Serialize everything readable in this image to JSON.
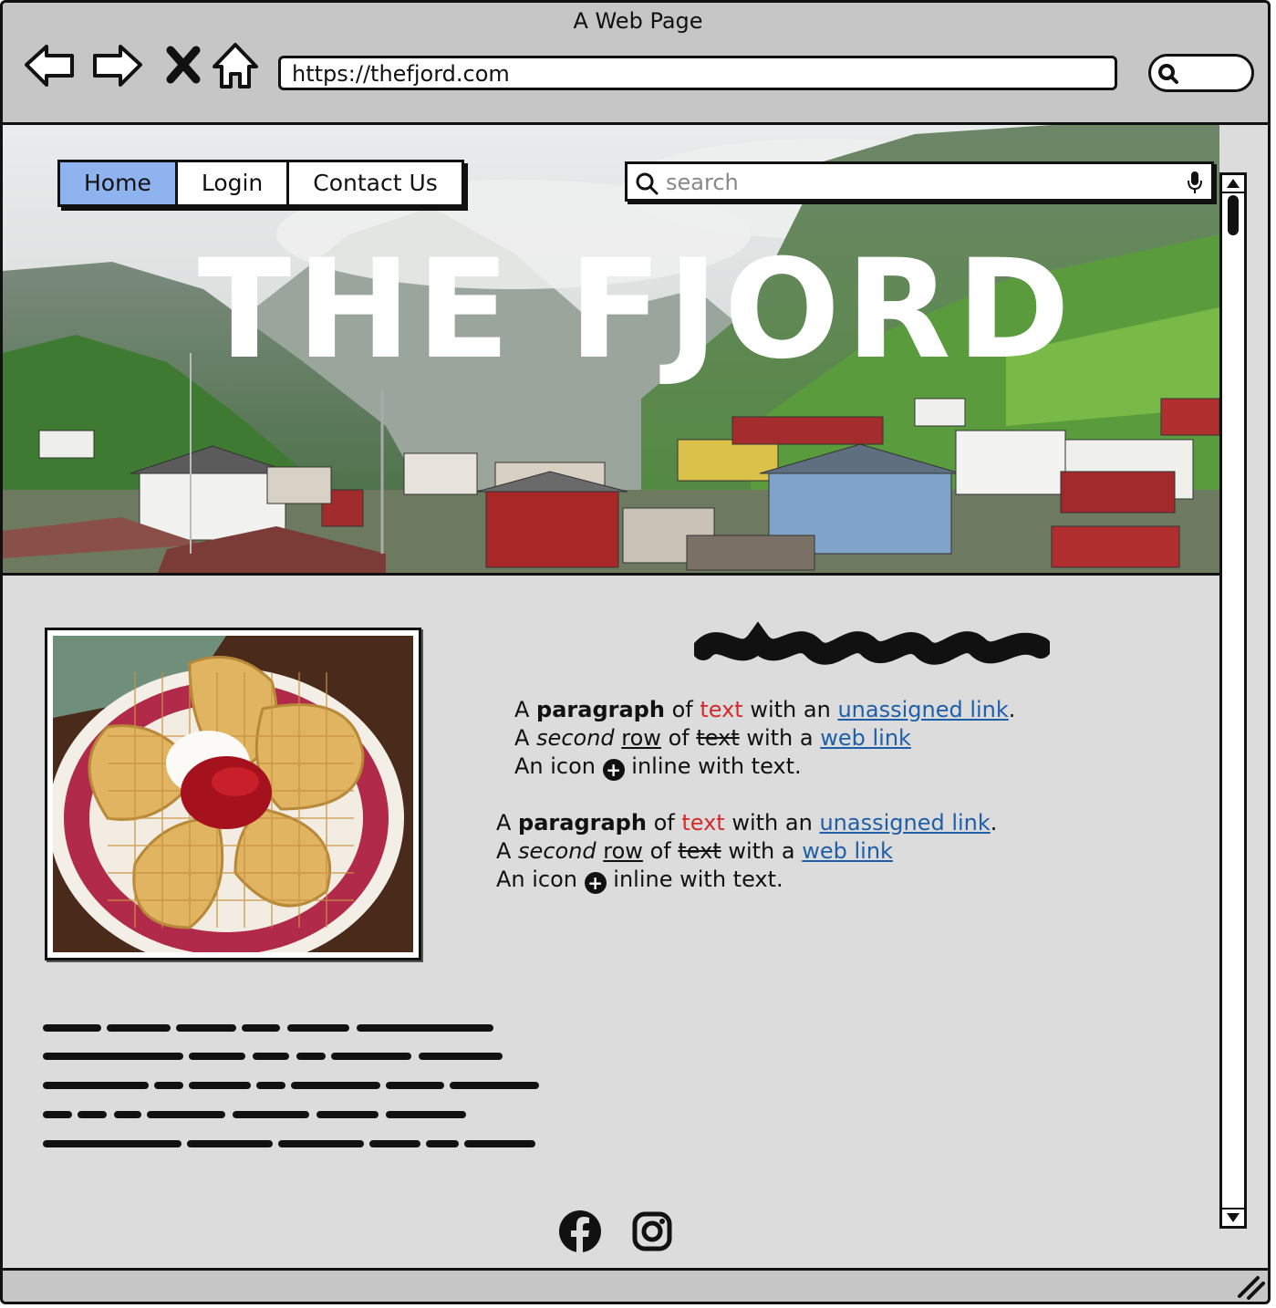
{
  "window": {
    "title": "A Web Page"
  },
  "browser": {
    "url": "https://thefjord.com",
    "buttons": [
      "back-icon",
      "forward-icon",
      "close-icon",
      "home-icon"
    ]
  },
  "nav": {
    "tabs": [
      {
        "label": "Home",
        "active": true
      },
      {
        "label": "Login",
        "active": false
      },
      {
        "label": "Contact Us",
        "active": false
      }
    ]
  },
  "search": {
    "placeholder": "search"
  },
  "hero": {
    "title": "THE FJORD"
  },
  "paragraph1": {
    "l1_a": "A ",
    "l1_bold": "paragraph",
    "l1_b": " of ",
    "l1_red": "text",
    "l1_c": " with an ",
    "l1_link": "unassigned link",
    "l1_d": ".",
    "l2_a": "A ",
    "l2_italic": "second",
    "l2_b": " ",
    "l2_underline": "row",
    "l2_c": " of ",
    "l2_strike": "text",
    "l2_d": " with a ",
    "l2_link": "web link",
    "l3_a": "An icon ",
    "l3_b": " inline with text."
  },
  "paragraph2": {
    "l1_a": "A ",
    "l1_bold": "paragraph",
    "l1_b": " of ",
    "l1_red": "text",
    "l1_c": " with an ",
    "l1_link": "unassigned link",
    "l1_d": ".",
    "l2_a": "A ",
    "l2_italic": "second",
    "l2_b": " ",
    "l2_underline": "row",
    "l2_c": " of ",
    "l2_strike": "text",
    "l2_d": " with a ",
    "l2_link": "web link",
    "l3_a": "An icon ",
    "l3_b": " inline with text."
  },
  "social": [
    "facebook-icon",
    "instagram-icon"
  ],
  "colors": {
    "tab_active": "#8fb3ef",
    "link": "#1f5fa8",
    "red_text": "#d32b2b",
    "chrome": "#c6c6c6",
    "page_bg": "#dcdcdc"
  }
}
